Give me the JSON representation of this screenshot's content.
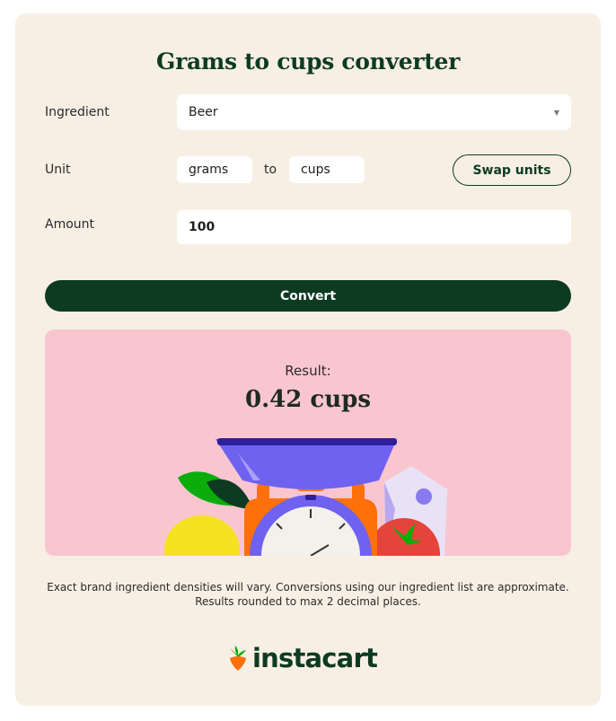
{
  "converter": {
    "title": "Grams to cups converter",
    "ingredient_label": "Ingredient",
    "ingredient_value": "Beer",
    "unit_label": "Unit",
    "from_unit": "grams",
    "to_text": "to",
    "to_unit": "cups",
    "swap_label": "Swap units",
    "amount_label": "Amount",
    "amount_value": "100",
    "convert_label": "Convert"
  },
  "result": {
    "label": "Result:",
    "value": "0.42 cups"
  },
  "disclaimer": {
    "line1": "Exact brand ingredient densities will vary. Conversions using our ingredient list are approximate.",
    "line2": "Results rounded to max 2 decimal places."
  },
  "brand": {
    "logo_text": "instacart",
    "logo_icon": "carrot-icon",
    "colors": {
      "primary": "#0d3b22",
      "card_bg": "#f8efe4",
      "result_bg": "#f9c6d0",
      "carrot_orange": "#ff7009",
      "carrot_green": "#0aad0a"
    }
  }
}
